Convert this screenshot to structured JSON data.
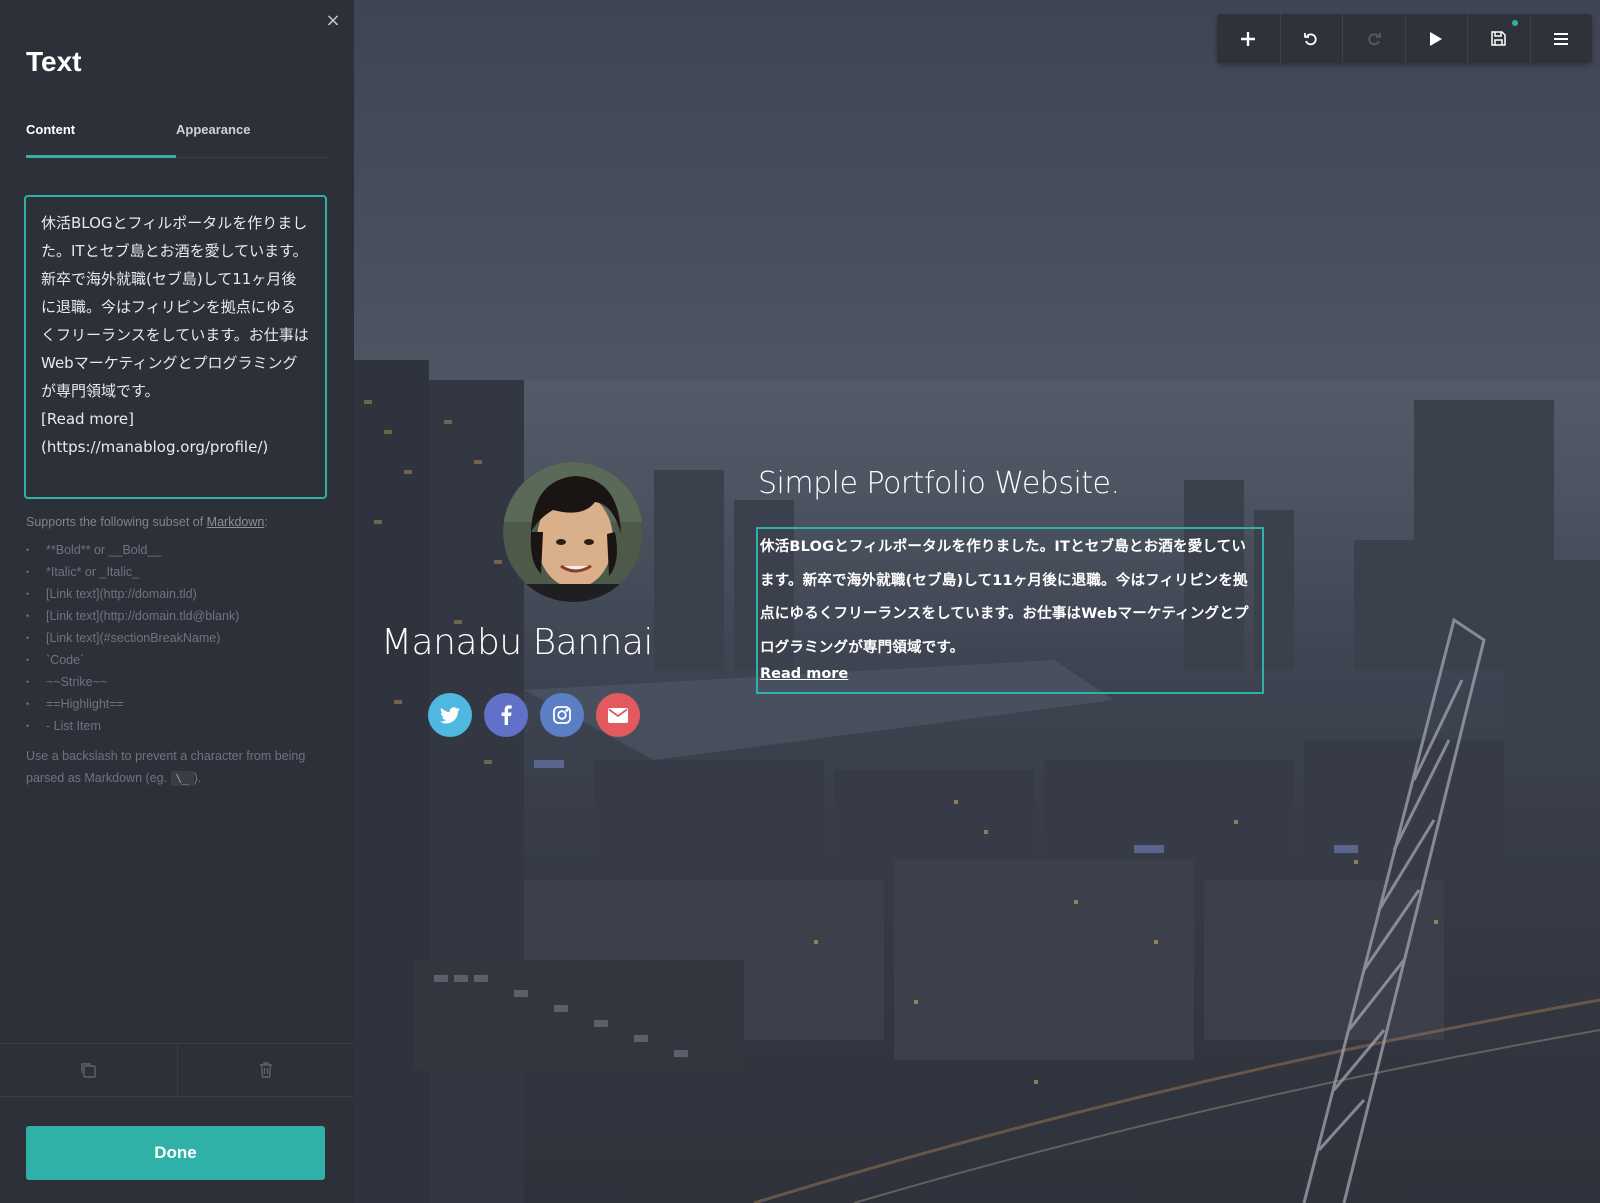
{
  "panel": {
    "close_label": "×",
    "title": "Text",
    "tabs": [
      {
        "label": "Content",
        "active": true
      },
      {
        "label": "Appearance",
        "active": false
      }
    ],
    "editor_value": "休活BLOGとフィルポータルを作りました。ITとセブ島とお酒を愛しています。新卒で海外就職(セブ島)して11ヶ月後に退職。今はフィリピンを拠点にゆるくフリーランスをしています。お仕事はWebマーケティングとプログラミングが専門領域です。\n[Read more]\n(https://manablog.org/profile/)",
    "help": {
      "intro_prefix": "Supports the following subset of ",
      "intro_link": "Markdown",
      "intro_suffix": ":",
      "items": [
        "**Bold** or __Bold__",
        "*Italic* or _Italic_",
        "[Link text](http://domain.tld)",
        "[Link text](http://domain.tld@blank)",
        "[Link text](#sectionBreakName)",
        "`Code`",
        "~~Strike~~",
        "==Highlight==",
        "- List Item"
      ],
      "note_prefix": "Use a backslash to prevent a character from being parsed as Markdown (eg. ",
      "note_code": "\\_",
      "note_suffix": ")."
    },
    "actions": [
      {
        "icon": "duplicate-icon"
      },
      {
        "icon": "trash-icon"
      }
    ],
    "done_label": "Done"
  },
  "toolbar": {
    "buttons": [
      {
        "icon": "plus-icon",
        "enabled": true
      },
      {
        "icon": "undo-icon",
        "enabled": true
      },
      {
        "icon": "redo-icon",
        "enabled": false
      },
      {
        "icon": "play-icon",
        "enabled": true
      },
      {
        "icon": "save-icon",
        "enabled": true,
        "indicator": true
      },
      {
        "icon": "menu-icon",
        "enabled": true
      }
    ],
    "accent": "#2fb1a8"
  },
  "site": {
    "name": "Manabu Bannai",
    "title": "Simple Portfolio Website.",
    "bio": "休活BLOGとフィルポータルを作りました。ITとセブ島とお酒を愛しています。新卒で海外就職(セブ島)して11ヶ月後に退職。今はフィリピンを拠点にゆるくフリーランスをしています。お仕事はWebマーケティングとプログラミングが専門領域です。",
    "read_more": "Read more",
    "socials": [
      {
        "icon": "twitter-icon",
        "color": "#4fb8e0"
      },
      {
        "icon": "facebook-icon",
        "color": "#6170c8"
      },
      {
        "icon": "instagram-icon",
        "color": "#5b7fc4"
      },
      {
        "icon": "email-icon",
        "color": "#e25a5f"
      }
    ]
  }
}
